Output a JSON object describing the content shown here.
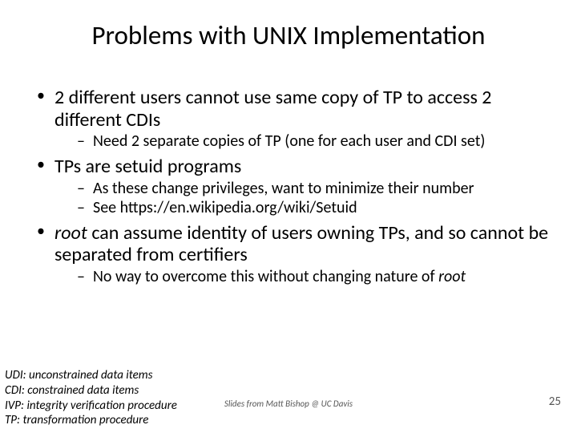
{
  "title": "Problems with UNIX Implementation",
  "bullets": [
    {
      "text": "2 different users cannot use same copy of TP to access 2 different CDIs",
      "sub": [
        "Need 2 separate copies of TP (one for each user and CDI set)"
      ]
    },
    {
      "text": "TPs are setuid programs",
      "sub": [
        "As these change privileges, want to minimize their number",
        "See https://en.wikipedia.org/wiki/Setuid"
      ]
    },
    {
      "text_pre": "root",
      "text_post": " can assume identity of users owning TPs, and so cannot be separated from certifiers",
      "sub_post": [
        {
          "pre": "No way to overcome this without changing nature of ",
          "it": "root"
        }
      ]
    }
  ],
  "footer": {
    "defs": [
      "UDI: unconstrained data items",
      "CDI: constrained data items",
      "IVP: integrity verification procedure",
      "TP: transformation procedure"
    ],
    "attribution": "Slides from Matt Bishop @ UC Davis",
    "page": "25"
  }
}
